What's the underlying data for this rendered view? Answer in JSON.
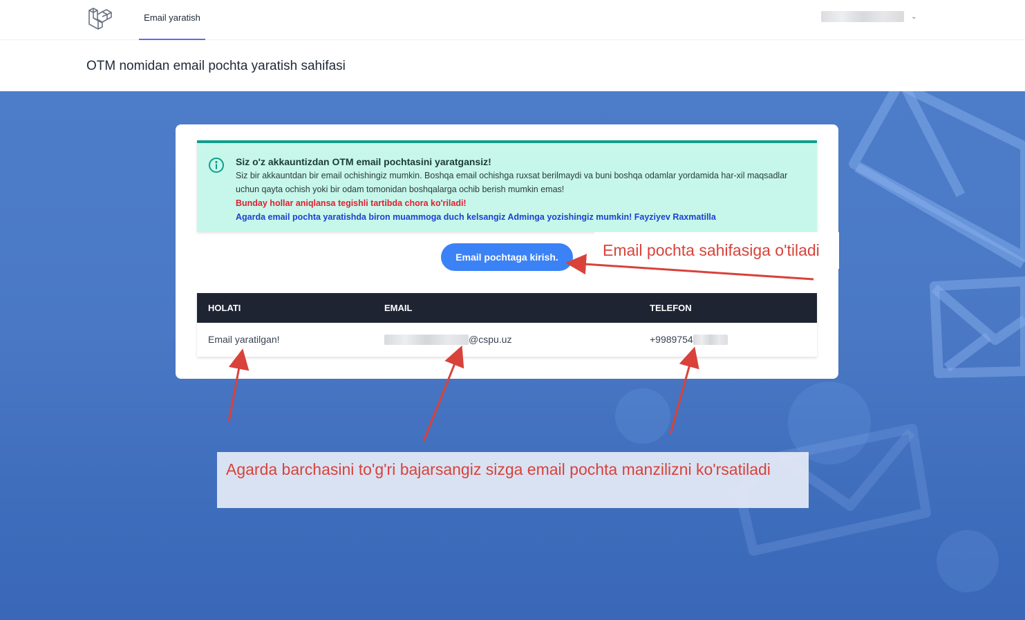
{
  "nav": {
    "link_label": "Email yaratish"
  },
  "header": {
    "title": "OTM nomidan email pochta yaratish sahifasi"
  },
  "alert": {
    "title": "Siz o'z akkauntizdan OTM email pochtasini yaratgansiz!",
    "text": "Siz bir akkauntdan bir email ochishingiz mumkin. Boshqa email ochishga ruxsat berilmaydi va buni boshqa odamlar yordamida har-xil maqsadlar uchun qayta ochish yoki bir odam tomonidan boshqalarga ochib berish mumkin emas!",
    "warning": "Bunday hollar aniqlansa tegishli tartibda chora ko'riladi!",
    "contact": "Agarda email pochta yaratishda biron muammoga duch kelsangiz Adminga yozishingiz mumkin! Fayziyev Raxmatilla"
  },
  "button": {
    "label": "Email pochtaga kirish."
  },
  "table": {
    "headers": [
      "HOLATI",
      "EMAIL",
      "TELEFON"
    ],
    "row": {
      "status": "Email yaratilgan!",
      "email_suffix": "@cspu.uz",
      "phone_prefix": "+9989754"
    }
  },
  "annotations": {
    "button_note": "Email pochta sahifasiga o'tiladi",
    "table_note": "Agarda barchasini to'g'ri bajarsangiz sizga email pochta manzilizni ko'rsatiladi"
  },
  "colors": {
    "accent": "#3b82f6",
    "alert_bg": "#c6f7ea",
    "alert_border": "#0f9e8c",
    "annotation": "#d8423a",
    "table_header": "#1f2433"
  }
}
